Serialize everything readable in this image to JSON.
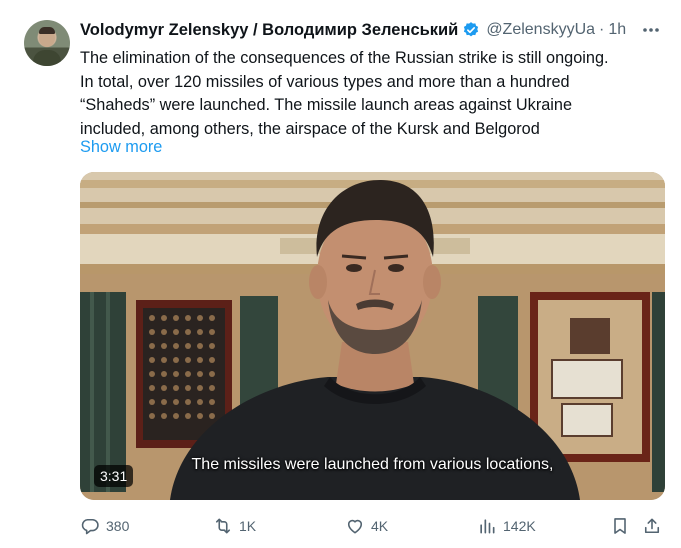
{
  "tweet": {
    "author_name": "Volodymyr Zelenskyy / Володимир Зеленський",
    "handle": "@ZelenskyyUa",
    "separator": "·",
    "time": "1h",
    "text_lines": [
      "The elimination of the consequences of the Russian strike is still ongoing.",
      "In total, over 120 missiles of various types and more than a hundred",
      "“Shaheds” were launched. The missile launch areas against Ukraine",
      "included, among others, the airspace of the Kursk and Belgorod"
    ],
    "show_more": "Show more"
  },
  "media": {
    "duration": "3:31",
    "caption": "The missiles were launched from various locations,"
  },
  "actions": {
    "replies": "380",
    "reposts": "1K",
    "likes": "4K",
    "views": "142K"
  },
  "colors": {
    "accent": "#1d9bf0",
    "secondary_text": "#536471"
  }
}
